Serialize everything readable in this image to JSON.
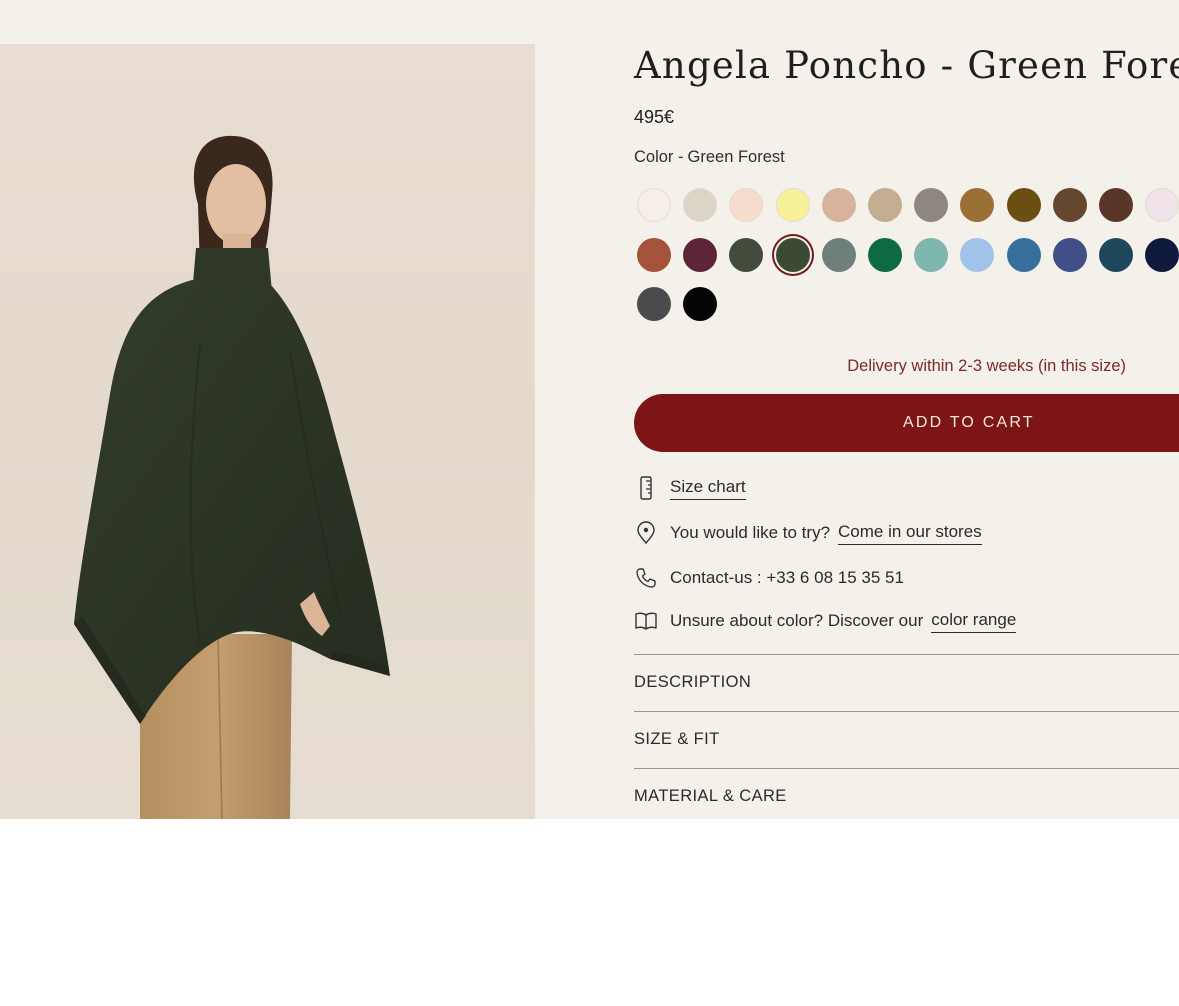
{
  "product": {
    "title": "Angela Poncho - Green Forest",
    "price": "495€",
    "color_label": "Color -",
    "color_name": "Green Forest",
    "image_alt": "Model wearing the Angela Poncho in Green Forest"
  },
  "swatches": [
    {
      "name": "swatch-1",
      "color": "#f6efe8",
      "selected": false
    },
    {
      "name": "swatch-2",
      "color": "#ddd4c8",
      "selected": false
    },
    {
      "name": "swatch-3",
      "color": "#f5dccc",
      "selected": false
    },
    {
      "name": "swatch-4",
      "color": "#f7f19a",
      "selected": false
    },
    {
      "name": "swatch-5",
      "color": "#d6b39a",
      "selected": false
    },
    {
      "name": "swatch-6",
      "color": "#c2ad90",
      "selected": false
    },
    {
      "name": "swatch-7",
      "color": "#8e8680",
      "selected": false
    },
    {
      "name": "swatch-8",
      "color": "#9a7036",
      "selected": false
    },
    {
      "name": "swatch-9",
      "color": "#6b4e12",
      "selected": false
    },
    {
      "name": "swatch-10",
      "color": "#65462f",
      "selected": false
    },
    {
      "name": "swatch-11",
      "color": "#5a3628",
      "selected": false
    },
    {
      "name": "swatch-12",
      "color": "#f1e3ea",
      "selected": false
    },
    {
      "name": "swatch-13",
      "color": "#a4523a",
      "selected": false
    },
    {
      "name": "swatch-14",
      "color": "#5e2538",
      "selected": false
    },
    {
      "name": "swatch-15",
      "color": "#434b3c",
      "selected": false
    },
    {
      "name": "swatch-16",
      "color": "#3c4a33",
      "selected": true
    },
    {
      "name": "swatch-17",
      "color": "#6f7f7a",
      "selected": false
    },
    {
      "name": "swatch-18",
      "color": "#0e6a42",
      "selected": false
    },
    {
      "name": "swatch-19",
      "color": "#7fb6ad",
      "selected": false
    },
    {
      "name": "swatch-20",
      "color": "#a2c3e8",
      "selected": false
    },
    {
      "name": "swatch-21",
      "color": "#3a6e9c",
      "selected": false
    },
    {
      "name": "swatch-22",
      "color": "#404f86",
      "selected": false
    },
    {
      "name": "swatch-23",
      "color": "#1d485c",
      "selected": false
    },
    {
      "name": "swatch-24",
      "color": "#0f1a3c",
      "selected": false
    },
    {
      "name": "swatch-25",
      "color": "#4a4b4d",
      "selected": false
    },
    {
      "name": "swatch-26",
      "color": "#050505",
      "selected": false
    }
  ],
  "delivery": "Delivery within 2-3 weeks (in this size)",
  "add_to_cart": "ADD TO CART",
  "actions": {
    "size_chart": {
      "icon": "ruler-icon",
      "link": "Size chart"
    },
    "stores": {
      "icon": "map-pin-icon",
      "text": "You would like to try?",
      "link": "Come in our stores"
    },
    "contact": {
      "icon": "phone-icon",
      "text": "Contact-us : +33 6 08 15 35 51"
    },
    "color_range": {
      "icon": "book-icon",
      "text": "Unsure about color? Discover our",
      "link": "color range"
    }
  },
  "accordion": [
    "DESCRIPTION",
    "SIZE & FIT",
    "MATERIAL & CARE"
  ],
  "colors": {
    "accent": "#7d1416",
    "background": "#f3f1ea",
    "delivery_text": "#7a2a2a"
  }
}
